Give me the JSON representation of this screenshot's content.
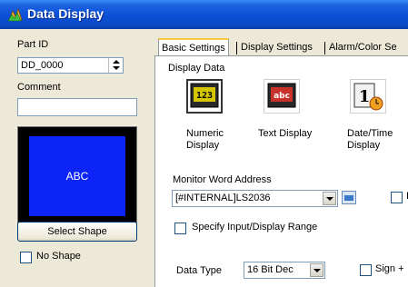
{
  "window": {
    "title": "Data Display",
    "icon": "data-display-app-icon"
  },
  "left": {
    "part_id_label": "Part ID",
    "part_id_value": "DD_0000",
    "comment_label": "Comment",
    "comment_value": "",
    "preview_text": "ABC",
    "select_shape_label": "Select Shape",
    "no_shape_label": "No Shape",
    "no_shape_checked": false
  },
  "tabs": [
    {
      "label": "Basic Settings",
      "active": true
    },
    {
      "label": "Display Settings",
      "active": false
    },
    {
      "label": "Alarm/Color Se",
      "active": false
    }
  ],
  "basic": {
    "display_data_label": "Display Data",
    "display_types": [
      {
        "label": "Numeric Display",
        "icon": "numeric-display-icon",
        "selected": true
      },
      {
        "label": "Text Display",
        "icon": "text-display-icon",
        "selected": false
      },
      {
        "label": "Date/Time Display",
        "icon": "date-time-display-icon",
        "selected": false
      }
    ],
    "monitor_address_label": "Monitor Word Address",
    "monitor_address_value": "[#INTERNAL]LS2036",
    "specify_range_label": "Specify Input/Display Range",
    "data_type_label": "Data Type",
    "data_type_value": "16 Bit Dec",
    "sign_label": "Sign +",
    "right_check_label": "I"
  },
  "colors": {
    "title_bar": "#0a4fd6",
    "preview_bg": "#0d24f7",
    "dialog_bg": "#ece9d8"
  }
}
